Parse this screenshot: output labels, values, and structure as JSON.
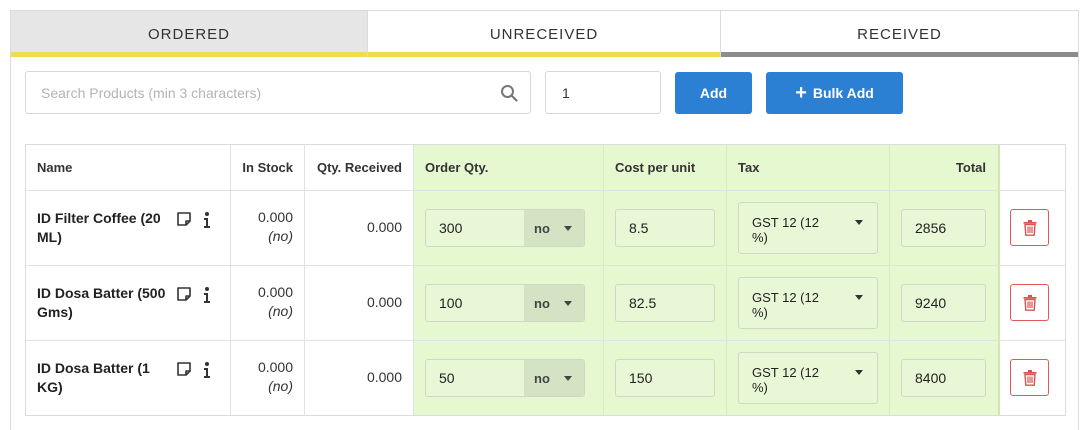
{
  "tabs": [
    {
      "label": "ORDERED",
      "bar_color": "#f2dc4a"
    },
    {
      "label": "UNRECEIVED",
      "bar_color": "#f2dc4a"
    },
    {
      "label": "RECEIVED",
      "bar_color": "#8c8c8c"
    }
  ],
  "search": {
    "placeholder": "Search Products (min 3 characters)",
    "value": ""
  },
  "quantity_input": {
    "value": "1"
  },
  "buttons": {
    "add_label": "Add",
    "bulk_add_label": "Bulk Add",
    "bulk_add_icon": "+"
  },
  "table": {
    "headers": {
      "name": "Name",
      "in_stock": "In Stock",
      "qty_received": "Qty. Received",
      "order_qty": "Order Qty.",
      "cost_per_unit": "Cost per unit",
      "tax": "Tax",
      "total": "Total"
    },
    "rows": [
      {
        "name": "ID Filter Coffee (20 ML)",
        "in_stock": "0.000",
        "stock_unit": "(no)",
        "qty_received": "0.000",
        "order_qty": "300",
        "order_unit": "no",
        "cost_per_unit": "8.5",
        "tax": "GST 12 (12 %)",
        "total": "2856"
      },
      {
        "name": "ID Dosa Batter (500 Gms)",
        "in_stock": "0.000",
        "stock_unit": "(no)",
        "qty_received": "0.000",
        "order_qty": "100",
        "order_unit": "no",
        "cost_per_unit": "82.5",
        "tax": "GST 12 (12 %)",
        "total": "9240"
      },
      {
        "name": "ID Dosa Batter (1 KG)",
        "in_stock": "0.000",
        "stock_unit": "(no)",
        "qty_received": "0.000",
        "order_qty": "50",
        "order_unit": "no",
        "cost_per_unit": "150",
        "tax": "GST 12 (12 %)",
        "total": "8400"
      }
    ]
  },
  "icons": {
    "search": "search-icon",
    "note": "note-icon",
    "info": "info-icon",
    "delete": "trash-icon",
    "dropdown": "caret-down-icon"
  },
  "colors": {
    "primary_button": "#2b80d4",
    "editable_column_bg": "#e5f8cf",
    "delete_red": "#e05a5a",
    "active_tab_bg": "#e6e6e6"
  }
}
